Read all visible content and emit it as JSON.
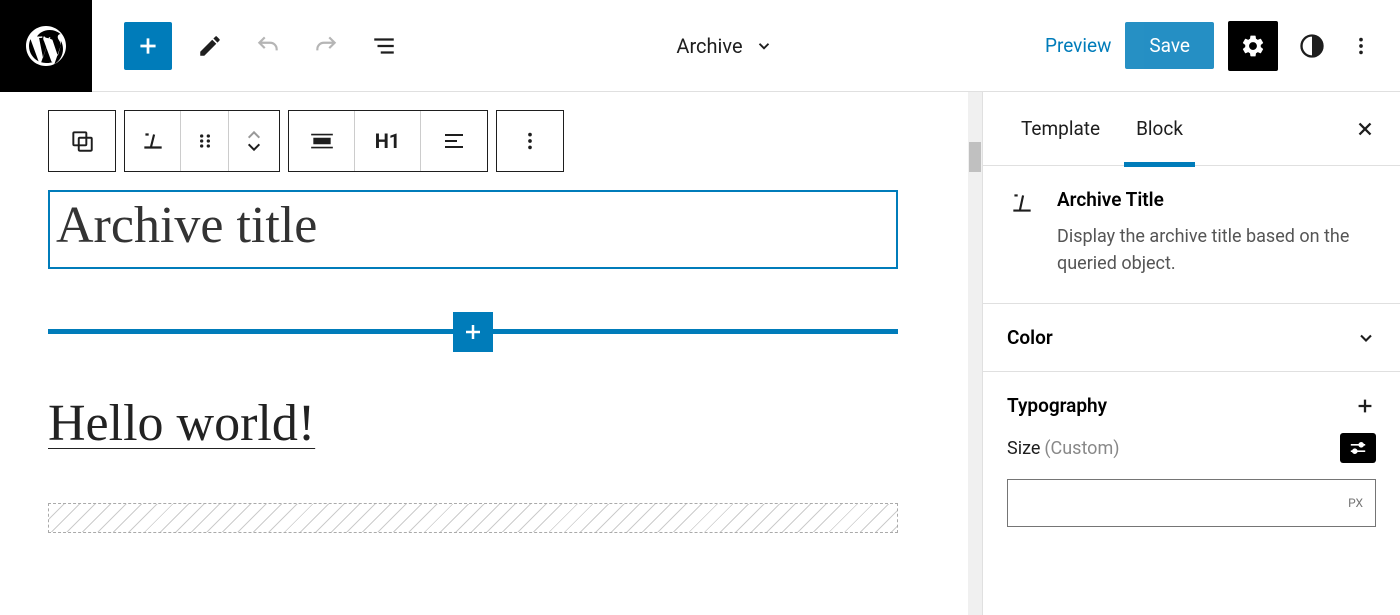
{
  "header": {
    "template_name": "Archive",
    "preview_label": "Preview",
    "save_label": "Save"
  },
  "canvas": {
    "archive_title": "Archive title",
    "post_title": "Hello world!"
  },
  "block_toolbar": {
    "heading_level": "H1"
  },
  "sidebar": {
    "tabs": [
      "Template",
      "Block"
    ],
    "active_tab": "Block",
    "block_info": {
      "name": "Archive Title",
      "description": "Display the archive title based on the queried object."
    },
    "panels": {
      "color": "Color",
      "typography": "Typography",
      "size_label": "Size",
      "size_mode": "(Custom)",
      "size_unit": "PX"
    }
  }
}
